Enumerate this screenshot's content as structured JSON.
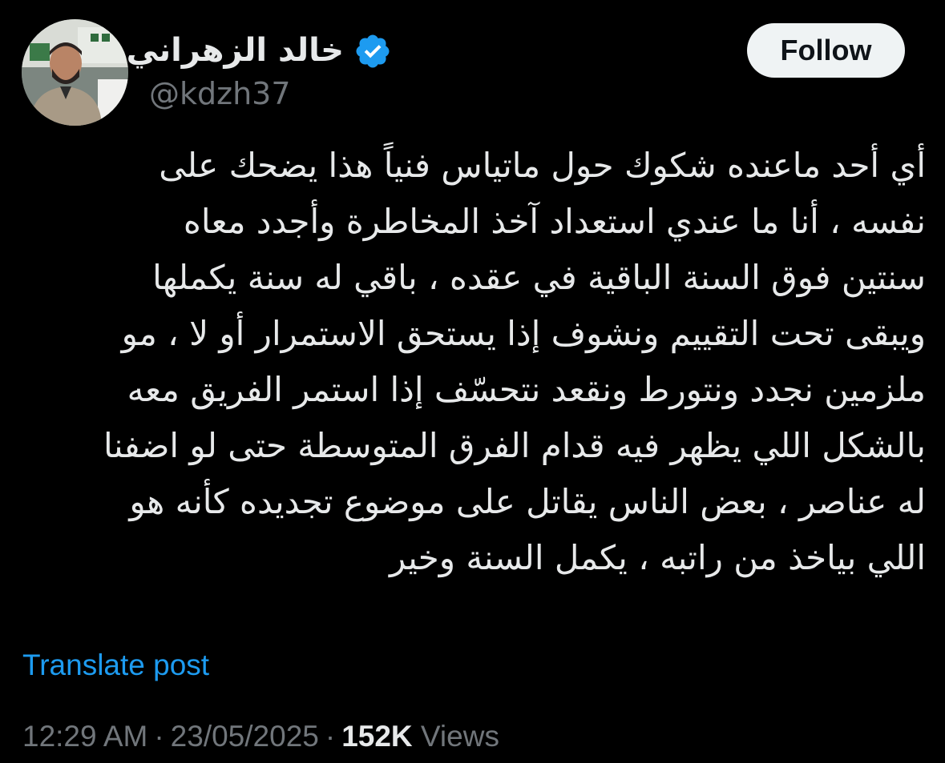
{
  "author": {
    "display_name": "خالد الزهراني",
    "handle": "@kdzh37",
    "verified": true,
    "avatar_icon": "profile-photo"
  },
  "follow_label": "Follow",
  "tweet": {
    "lines": [
      "أي أحد ماعنده شكوك حول ماتياس فنياً هذا يضحك على",
      "نفسه ، أنا ما عندي استعداد آخذ المخاطرة وأجدد معاه",
      "سنتين فوق السنة الباقية في عقده ، باقي له سنة يكملها",
      "ويبقى تحت التقييم ونشوف إذا يستحق الاستمرار أو لا ، مو",
      "ملزمين نجدد ونتورط ونقعد نتحسّف إذا استمر الفريق معه",
      "بالشكل اللي يظهر فيه قدام الفرق المتوسطة حتى لو اضفنا",
      "له عناصر ، بعض الناس يقاتل على موضوع تجديده كأنه هو",
      "اللي بياخذ من راتبه ، يكمل السنة وخير"
    ]
  },
  "translate_label": "Translate post",
  "meta": {
    "time": "12:29 AM",
    "separator": "·",
    "date": "23/05/2025",
    "views_count": "152K",
    "views_label": "Views"
  },
  "colors": {
    "background": "#000000",
    "text": "#e7e9ea",
    "muted": "#71767b",
    "link": "#1d9bf0",
    "verified": "#1d9bf0",
    "follow_bg": "#eff3f4"
  }
}
